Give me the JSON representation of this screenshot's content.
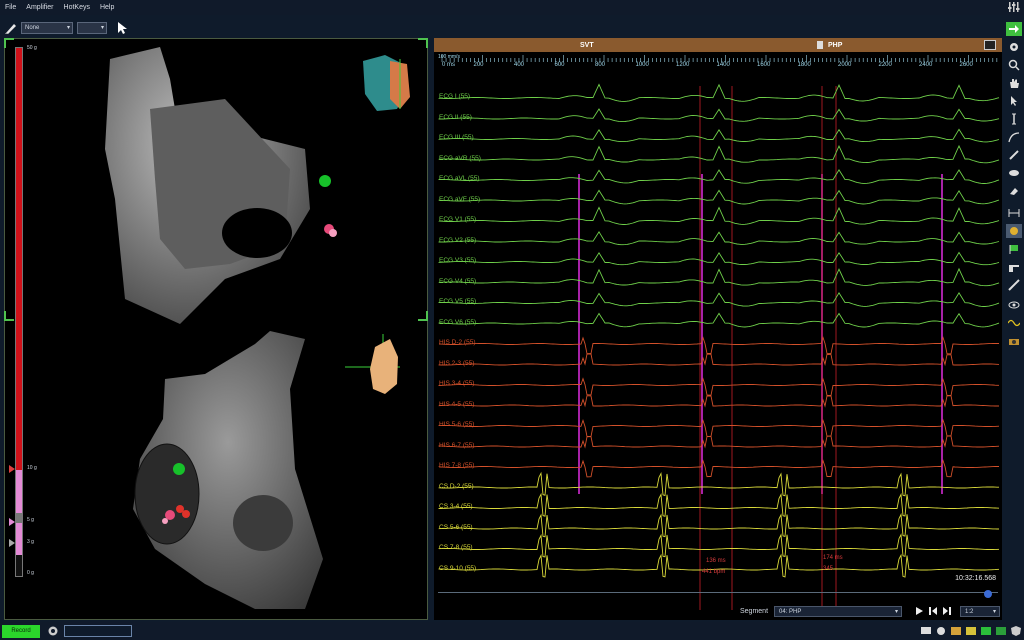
{
  "menu": {
    "items": [
      "File",
      "Amplifier",
      "HotKeys",
      "Help"
    ]
  },
  "toolbar": {
    "map_select": "None",
    "second_select": ""
  },
  "pressure_scale": {
    "labels": [
      "50 g",
      "10 g",
      "5 g",
      "3 g",
      "0 g"
    ],
    "red_level": 0.8
  },
  "segment_header": {
    "left_label": "SVT",
    "right_label": "PHP"
  },
  "ruler": {
    "speed": "100 mm/s",
    "ticks": [
      "0 ms",
      "200",
      "400",
      "600",
      "800",
      "1000",
      "1200",
      "1400",
      "1600",
      "1800",
      "2000",
      "2200",
      "2400",
      "2600"
    ]
  },
  "channels": [
    {
      "label": "ECG I (55)",
      "group": "ecg"
    },
    {
      "label": "ECG II (55)",
      "group": "ecg"
    },
    {
      "label": "ECG III (55)",
      "group": "ecg"
    },
    {
      "label": "ECG aVR (55)",
      "group": "ecg"
    },
    {
      "label": "ECG aVL (55)",
      "group": "ecg"
    },
    {
      "label": "ECG aVF (55)",
      "group": "ecg"
    },
    {
      "label": "ECG V1 (55)",
      "group": "ecg"
    },
    {
      "label": "ECG V2 (55)",
      "group": "ecg"
    },
    {
      "label": "ECG V3 (55)",
      "group": "ecg"
    },
    {
      "label": "ECG V4 (55)",
      "group": "ecg"
    },
    {
      "label": "ECG V5 (55)",
      "group": "ecg"
    },
    {
      "label": "ECG V6 (55)",
      "group": "ecg"
    },
    {
      "label": "HIS D-2 (55)",
      "group": "his"
    },
    {
      "label": "HIS 2-3 (55)",
      "group": "his"
    },
    {
      "label": "HIS 3-4 (55)",
      "group": "his"
    },
    {
      "label": "HIS 4-5 (55)",
      "group": "his"
    },
    {
      "label": "HIS 5-6 (55)",
      "group": "his"
    },
    {
      "label": "HIS 6-7 (55)",
      "group": "his"
    },
    {
      "label": "HIS 7-8 (55)",
      "group": "his"
    },
    {
      "label": "CS D-2 (55)",
      "group": "cs"
    },
    {
      "label": "CS 3-4 (55)",
      "group": "cs"
    },
    {
      "label": "CS 5-6 (55)",
      "group": "cs"
    },
    {
      "label": "CS 7-8 (55)",
      "group": "cs"
    },
    {
      "label": "CS 9-10 (55)",
      "group": "cs"
    }
  ],
  "calipers": [
    {
      "ms": "136 ms",
      "bpm": "441 bpm"
    },
    {
      "ms": "174 ms",
      "bpm": "345"
    }
  ],
  "time_readout": "10:32:16.568",
  "segment_bar": {
    "label": "Segment",
    "value": "04:  PHP",
    "zoom": "1:2"
  },
  "statusbar": {
    "record_label": "Record",
    "command_value": ""
  },
  "colors": {
    "ecg": "#6fcf4a",
    "his": "#d2502a",
    "cs": "#d8d83a",
    "pacing": "#d32bd3",
    "caliper": "#c8202a",
    "accent": "#2bd62b",
    "segment_header": "#8a5a2e"
  }
}
